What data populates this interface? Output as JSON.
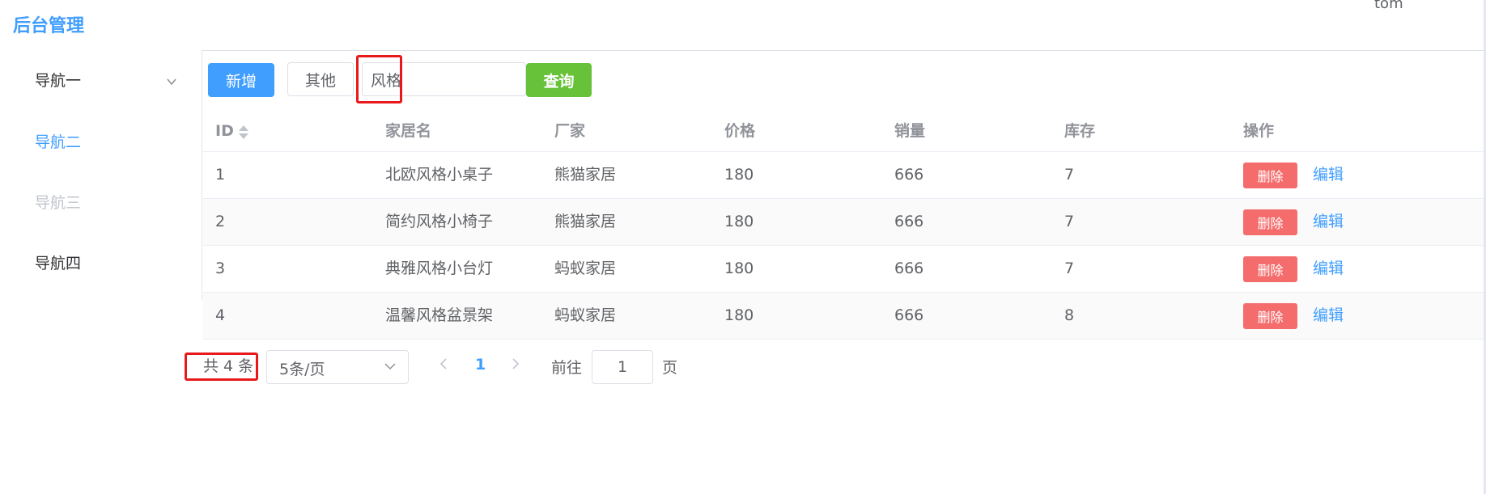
{
  "header": {
    "title": "后台管理",
    "user": "tom"
  },
  "sidebar": {
    "items": [
      {
        "label": "导航一"
      },
      {
        "label": "导航二"
      },
      {
        "label": "导航三"
      },
      {
        "label": "导航四"
      }
    ]
  },
  "toolbar": {
    "add_label": "新增",
    "other_label": "其他",
    "search_value": "风格",
    "query_label": "查询"
  },
  "table": {
    "headers": [
      "ID",
      "家居名",
      "厂家",
      "价格",
      "销量",
      "库存",
      "操作"
    ],
    "rows": [
      {
        "id": "1",
        "name": "北欧风格小桌子",
        "maker": "熊猫家居",
        "price": "180",
        "sales": "666",
        "stock": "7"
      },
      {
        "id": "2",
        "name": "简约风格小椅子",
        "maker": "熊猫家居",
        "price": "180",
        "sales": "666",
        "stock": "7"
      },
      {
        "id": "3",
        "name": "典雅风格小台灯",
        "maker": "蚂蚁家居",
        "price": "180",
        "sales": "666",
        "stock": "7"
      },
      {
        "id": "4",
        "name": "温馨风格盆景架",
        "maker": "蚂蚁家居",
        "price": "180",
        "sales": "666",
        "stock": "8"
      }
    ],
    "delete_label": "删除",
    "edit_label": "编辑"
  },
  "pagination": {
    "total": "共 4 条",
    "page_size": "5条/页",
    "current_page": "1",
    "goto_label": "前往",
    "goto_value": "1",
    "page_suffix": "页"
  },
  "colors": {
    "primary": "#409eff",
    "success": "#67c23a",
    "danger": "#f56c6c",
    "highlight": "#e7191a"
  }
}
